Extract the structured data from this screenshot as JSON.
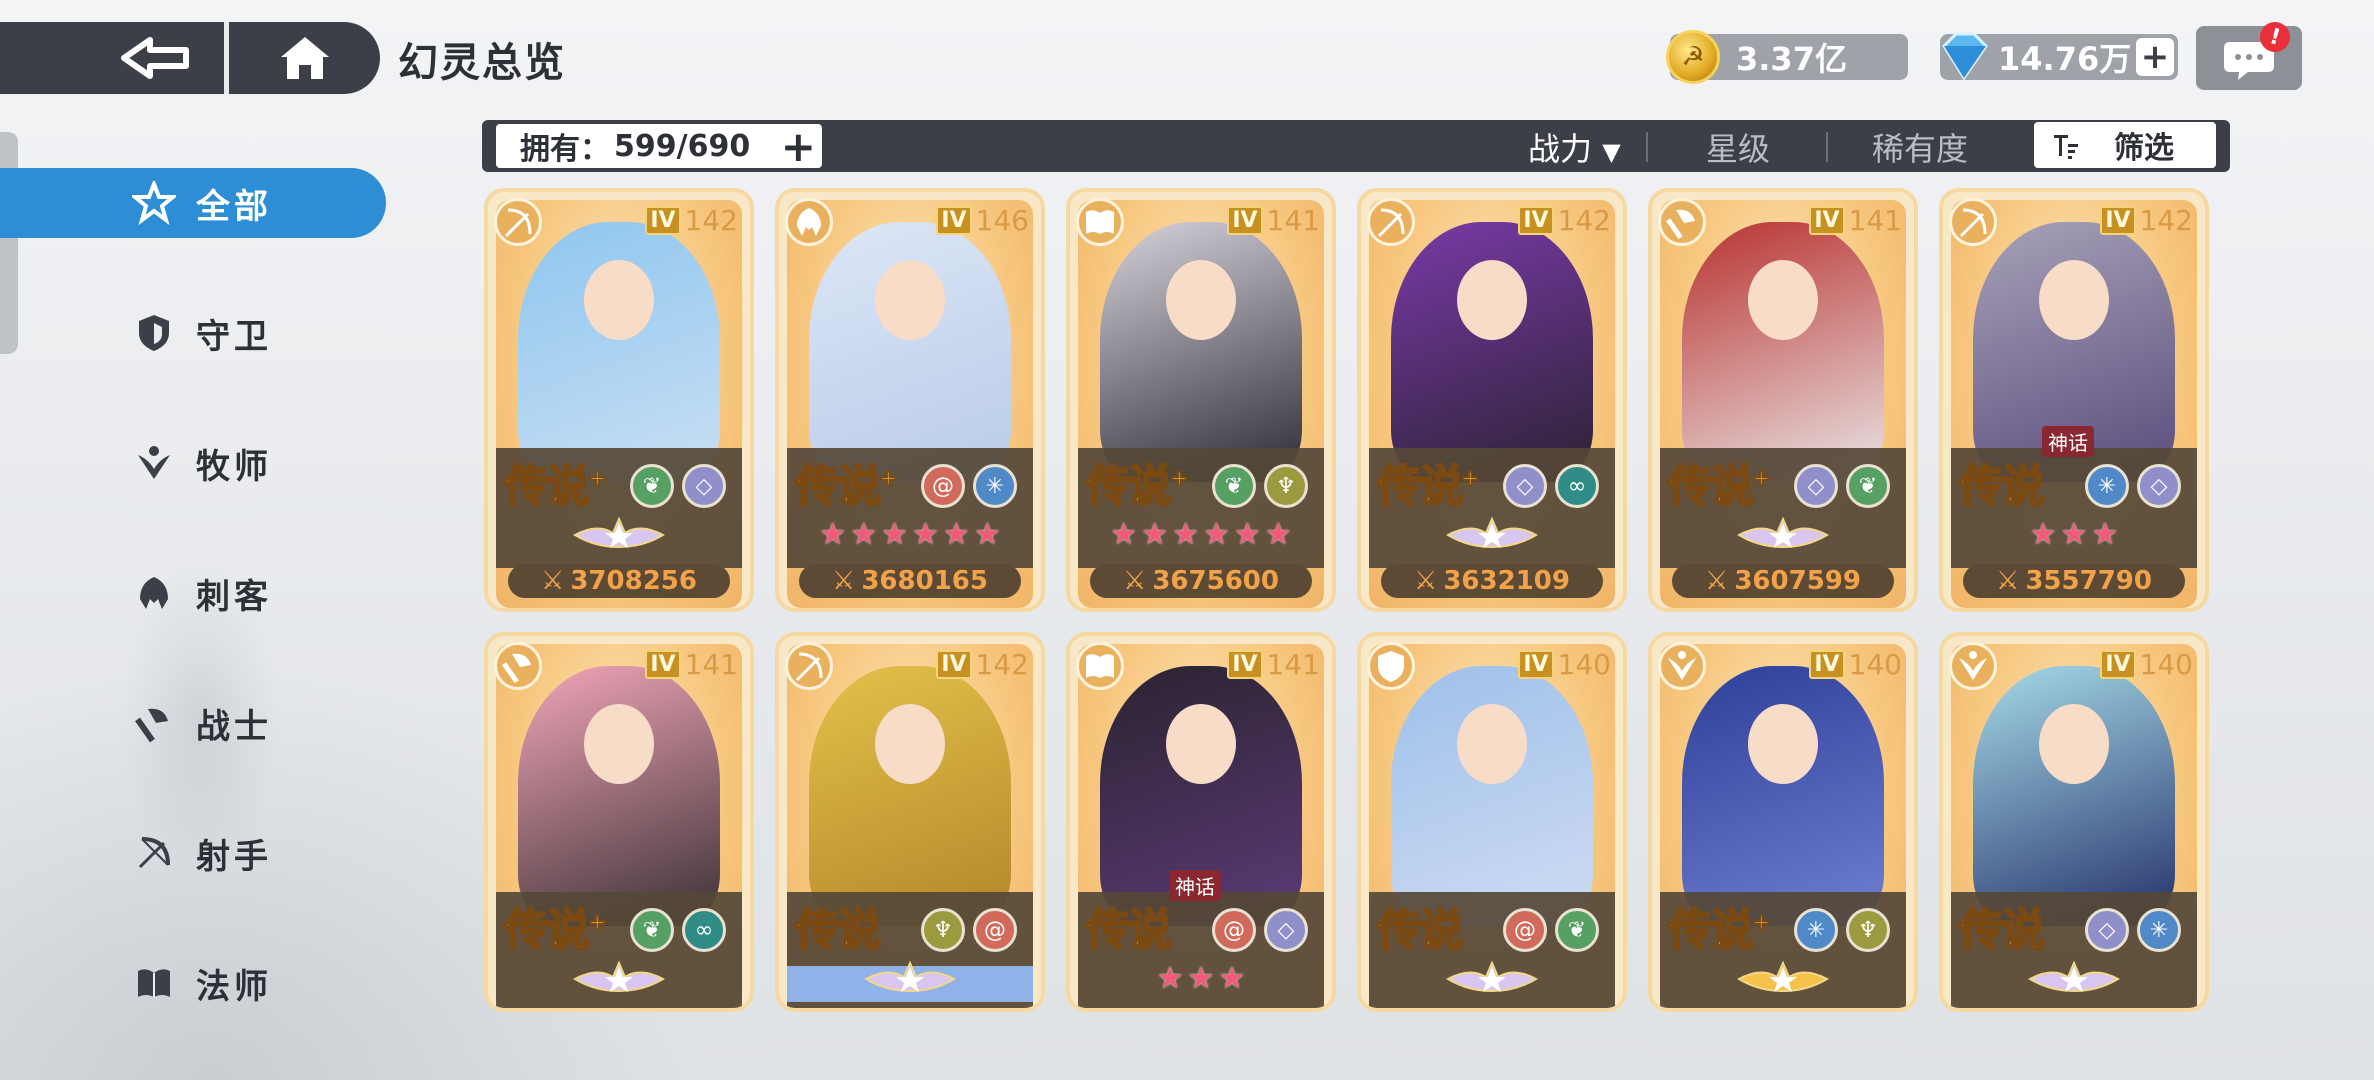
{
  "header": {
    "title": "幻灵总览",
    "gold": "3.37亿",
    "gems": "14.76万",
    "plus": "+",
    "chat_badge": "!"
  },
  "sidebar": {
    "items": [
      {
        "label": "全部",
        "icon": "star-icon",
        "active": true
      },
      {
        "label": "守卫",
        "icon": "shield-icon"
      },
      {
        "label": "牧师",
        "icon": "wing-icon"
      },
      {
        "label": "刺客",
        "icon": "hood-icon"
      },
      {
        "label": "战士",
        "icon": "axe-icon"
      },
      {
        "label": "射手",
        "icon": "bow-icon"
      },
      {
        "label": "法师",
        "icon": "book-icon"
      }
    ]
  },
  "toolbar": {
    "own_label": "拥有：",
    "own_count": "599/690",
    "sort_power": "战力",
    "sort_star": "星级",
    "sort_rarity": "稀有度",
    "filter": "筛选"
  },
  "cards": [
    {
      "class": "bow",
      "rank": "IV",
      "level": "142",
      "grade": "传说",
      "plus": "+",
      "elements": [
        "leaf",
        "gem"
      ],
      "stars": "crest",
      "power": "3708256",
      "palette": [
        "#8fc6ef",
        "#c9dff3"
      ]
    },
    {
      "class": "hood",
      "rank": "IV",
      "level": "146",
      "grade": "传说",
      "plus": "+",
      "elements": [
        "spiral",
        "snow"
      ],
      "stars": "6",
      "power": "3680165",
      "palette": [
        "#dce6f6",
        "#b9cbe8"
      ]
    },
    {
      "class": "book",
      "rank": "IV",
      "level": "141",
      "grade": "传说",
      "plus": "+",
      "elements": [
        "leaf",
        "wing"
      ],
      "stars": "6",
      "power": "3675600",
      "palette": [
        "#d7d3dc",
        "#2c2a33"
      ]
    },
    {
      "class": "bow",
      "rank": "IV",
      "level": "142",
      "grade": "传说",
      "plus": "+",
      "elements": [
        "gem",
        "loop"
      ],
      "stars": "crest",
      "power": "3632109",
      "palette": [
        "#7a3aa8",
        "#2b2233"
      ]
    },
    {
      "class": "axe",
      "rank": "IV",
      "level": "141",
      "grade": "传说",
      "plus": "+",
      "elements": [
        "gem",
        "leaf"
      ],
      "stars": "crest",
      "power": "3607599",
      "palette": [
        "#b8322f",
        "#e9e6e6"
      ]
    },
    {
      "class": "bow",
      "rank": "IV",
      "level": "142",
      "grade": "传说",
      "plus": "",
      "myth": "神话",
      "elements": [
        "snow",
        "gem"
      ],
      "stars": "3",
      "power": "3557790",
      "palette": [
        "#a7a2b8",
        "#5a4c7c"
      ]
    },
    {
      "class": "axe",
      "rank": "IV",
      "level": "141",
      "grade": "传说",
      "plus": "+",
      "elements": [
        "leaf",
        "loop"
      ],
      "stars": "crest",
      "palette": [
        "#f2a6b8",
        "#3a3034"
      ]
    },
    {
      "class": "bow",
      "rank": "IV",
      "level": "142",
      "grade": "传说",
      "plus": "",
      "elements": [
        "wing",
        "spiral"
      ],
      "stars": "crest-blue",
      "palette": [
        "#e3c24a",
        "#b4852a"
      ]
    },
    {
      "class": "book",
      "rank": "IV",
      "level": "141",
      "grade": "传说",
      "plus": "",
      "myth": "神话",
      "elements": [
        "spiral",
        "gem"
      ],
      "stars": "3",
      "palette": [
        "#2a2330",
        "#5c3b77"
      ]
    },
    {
      "class": "shield",
      "rank": "IV",
      "level": "140",
      "grade": "传说",
      "plus": "",
      "elements": [
        "spiral",
        "leaf"
      ],
      "stars": "crest",
      "palette": [
        "#9ec0ea",
        "#cfdcf3"
      ]
    },
    {
      "class": "wing",
      "rank": "IV",
      "level": "140",
      "grade": "传说",
      "plus": "+",
      "elements": [
        "snow",
        "wing"
      ],
      "stars": "crest-gold",
      "palette": [
        "#2e3f9a",
        "#6f7fd0"
      ]
    },
    {
      "class": "wing",
      "rank": "IV",
      "level": "140",
      "grade": "传说",
      "plus": "",
      "elements": [
        "gem",
        "snow"
      ],
      "stars": "crest",
      "palette": [
        "#a6dbe8",
        "#24306a"
      ]
    }
  ]
}
